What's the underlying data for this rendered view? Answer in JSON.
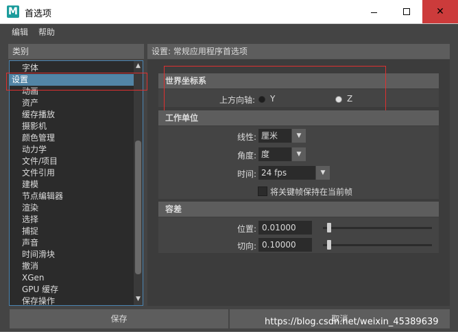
{
  "window": {
    "icon_letter": "M",
    "title": "首选项",
    "close_glyph": "✕"
  },
  "menu": {
    "items": [
      "编辑",
      "帮助"
    ]
  },
  "categories": {
    "header": "类别",
    "items": [
      "字体",
      "设置",
      "动画",
      "资产",
      "缓存播放",
      "摄影机",
      "颜色管理",
      "动力学",
      "文件/项目",
      "文件引用",
      "建模",
      "节点编辑器",
      "渲染",
      "选择",
      "捕捉",
      "声音",
      "时间滑块",
      "撤消",
      "XGen",
      "GPU 缓存",
      "保存操作"
    ],
    "selected": "设置"
  },
  "settings": {
    "header": "设置: 常规应用程序首选项",
    "world_coords": {
      "title": "世界坐标系",
      "up_axis_label": "上方向轴:",
      "options": [
        "Y",
        "Z"
      ],
      "selected": "Z"
    },
    "working_units": {
      "title": "工作单位",
      "linear_label": "线性:",
      "linear_value": "厘米",
      "angular_label": "角度:",
      "angular_value": "度",
      "time_label": "时间:",
      "time_value": "24 fps",
      "keep_keys_label": "将关键帧保持在当前帧",
      "keep_keys_checked": false
    },
    "tolerance": {
      "title": "容差",
      "position_label": "位置:",
      "position_value": "0.01000",
      "position_slider": 0.02,
      "tangent_label": "切向:",
      "tangent_value": "0.10000",
      "tangent_slider": 0.02
    }
  },
  "buttons": {
    "save": "保存",
    "cancel": "取消"
  },
  "watermark": "https://blog.csdn.net/weixin_45389639",
  "colors": {
    "highlight_box": "#e03030",
    "selection": "#5285a6",
    "close_button": "#cc3b3b"
  }
}
